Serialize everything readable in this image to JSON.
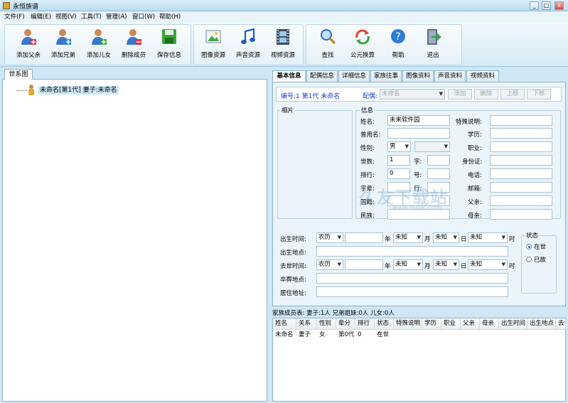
{
  "window": {
    "title": "永恒族谱",
    "min_glyph": "_",
    "max_glyph": "□",
    "close_glyph": "x"
  },
  "menu": [
    "文件(F)",
    "编辑(E)",
    "视图(V)",
    "工具(T)",
    "管理(A)",
    "窗口(W)",
    "帮助(H)"
  ],
  "toolbar": {
    "group1": [
      {
        "label": "添加父亲",
        "icon": "add-father-icon"
      },
      {
        "label": "添加兄弟",
        "icon": "add-sibling-icon"
      },
      {
        "label": "添加儿女",
        "icon": "add-child-icon"
      },
      {
        "label": "删除成员",
        "icon": "delete-member-icon"
      },
      {
        "label": "保存信息",
        "icon": "save-icon"
      }
    ],
    "group2": [
      {
        "label": "图像资源",
        "icon": "image-icon"
      },
      {
        "label": "声音资源",
        "icon": "music-icon"
      },
      {
        "label": "视频资源",
        "icon": "video-icon"
      }
    ],
    "group3": [
      {
        "label": "查找",
        "icon": "search-icon"
      },
      {
        "label": "公元换算",
        "icon": "convert-icon"
      },
      {
        "label": "帮助",
        "icon": "help-icon"
      },
      {
        "label": "退出",
        "icon": "exit-icon"
      }
    ]
  },
  "tree": {
    "tab": "世系图",
    "root": "未命名[第1代] 妻子:未命名"
  },
  "tabs": [
    "基本信息",
    "配偶信息",
    "详细信息",
    "家族往事",
    "图像资料",
    "声音资料",
    "视频资料"
  ],
  "subbar": {
    "member_info": "编号:1 第1代 未命名",
    "spouse_label": "配偶:",
    "spouse_value": "未命名",
    "buttons": [
      "添加",
      "删除",
      "上移",
      "下移"
    ]
  },
  "photo": {
    "legend": "相片"
  },
  "info": {
    "legend": "信息",
    "name_label": "姓名:",
    "name_value": "未来软件园",
    "former_name_label": "曾用名:",
    "former_name_value": "",
    "gender_label": "性别:",
    "gender_value": "男",
    "generation_label": "世数:",
    "generation_value": "1",
    "courtesy_label": "字:",
    "rank_label": "排行:",
    "rank_value": "0",
    "alias_label": "号:",
    "zibei_label": "字辈:",
    "hang_label": "行:",
    "nationality_label": "国籍:",
    "ethnicity_label": "民族:",
    "special_label": "特殊说明:",
    "education_label": "学历:",
    "job_label": "职业:",
    "id_label": "身份证:",
    "phone_label": "电话:",
    "email_label": "邮箱:",
    "father_label": "父亲:",
    "mother_label": "母亲:"
  },
  "dates": {
    "birth_label": "出生时间:",
    "birth_place_label": "出生地点:",
    "death_label": "去世时间:",
    "burial_label": "卒葬地点:",
    "residence_label": "居住地址:",
    "calendar": "农历",
    "unknown": "未知",
    "year": "年",
    "month": "月",
    "day": "日",
    "hour": "时"
  },
  "status": {
    "legend": "状态",
    "alive": "在世",
    "deceased": "已故"
  },
  "family": {
    "summary": "家族成员表: 妻子:1人 兄弟姐妹:0人 儿女:0人",
    "columns": [
      "姓名",
      "关系",
      "性别",
      "辈分",
      "排行",
      "状态",
      "特殊说明",
      "学历",
      "职业",
      "父亲",
      "母亲",
      "出生时间",
      "出生地点",
      "去世"
    ],
    "rows": [
      [
        "未命名",
        "妻子",
        "女",
        "第0代",
        "0",
        "在世"
      ]
    ]
  },
  "watermark": {
    "main": "久友下载站",
    "sub": "www.9upk.com"
  },
  "colors": {
    "accent_blue": "#1a3ccf",
    "selection": "#cbe8f4"
  }
}
